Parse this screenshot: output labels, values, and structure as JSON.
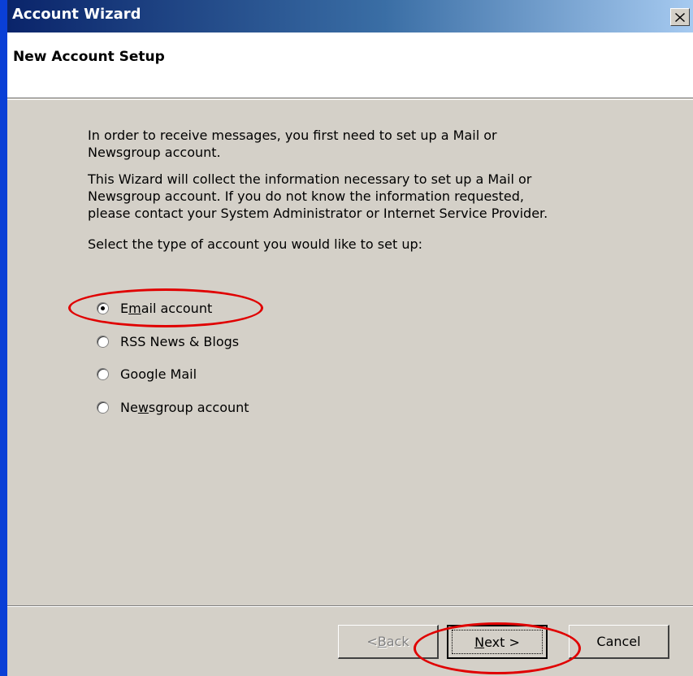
{
  "window": {
    "title": "Account Wizard",
    "close_label": "×"
  },
  "header": {
    "title": "New Account Setup"
  },
  "content": {
    "intro_line1": "In order to receive messages, you first need to set up a Mail or",
    "intro_line2": "Newsgroup account.",
    "info_line1": "This Wizard will collect the information necessary to set up a Mail or",
    "info_line2": "Newsgroup account. If you do not know the information requested,",
    "info_line3": "please contact your System Administrator or Internet Service Provider.",
    "prompt": "Select the type of account you would like to set up:"
  },
  "account_types": [
    {
      "pre": "E",
      "u": "m",
      "post": "ail account",
      "selected": true
    },
    {
      "pre": "RSS News & Blogs",
      "u": "",
      "post": "",
      "selected": false
    },
    {
      "pre": "Google Mail",
      "u": "",
      "post": "",
      "selected": false
    },
    {
      "pre": "Ne",
      "u": "w",
      "post": "sgroup account",
      "selected": false
    }
  ],
  "buttons": {
    "back": {
      "pre": "< ",
      "u": "B",
      "post": "ack",
      "enabled": false
    },
    "next": {
      "pre": "",
      "u": "N",
      "post": "ext >",
      "enabled": true
    },
    "cancel": {
      "label": "Cancel"
    }
  },
  "colors": {
    "annotation": "#e00000",
    "dialog_face": "#d4d0c8",
    "titlebar_start": "#0a246a",
    "titlebar_end": "#a6caf0"
  }
}
